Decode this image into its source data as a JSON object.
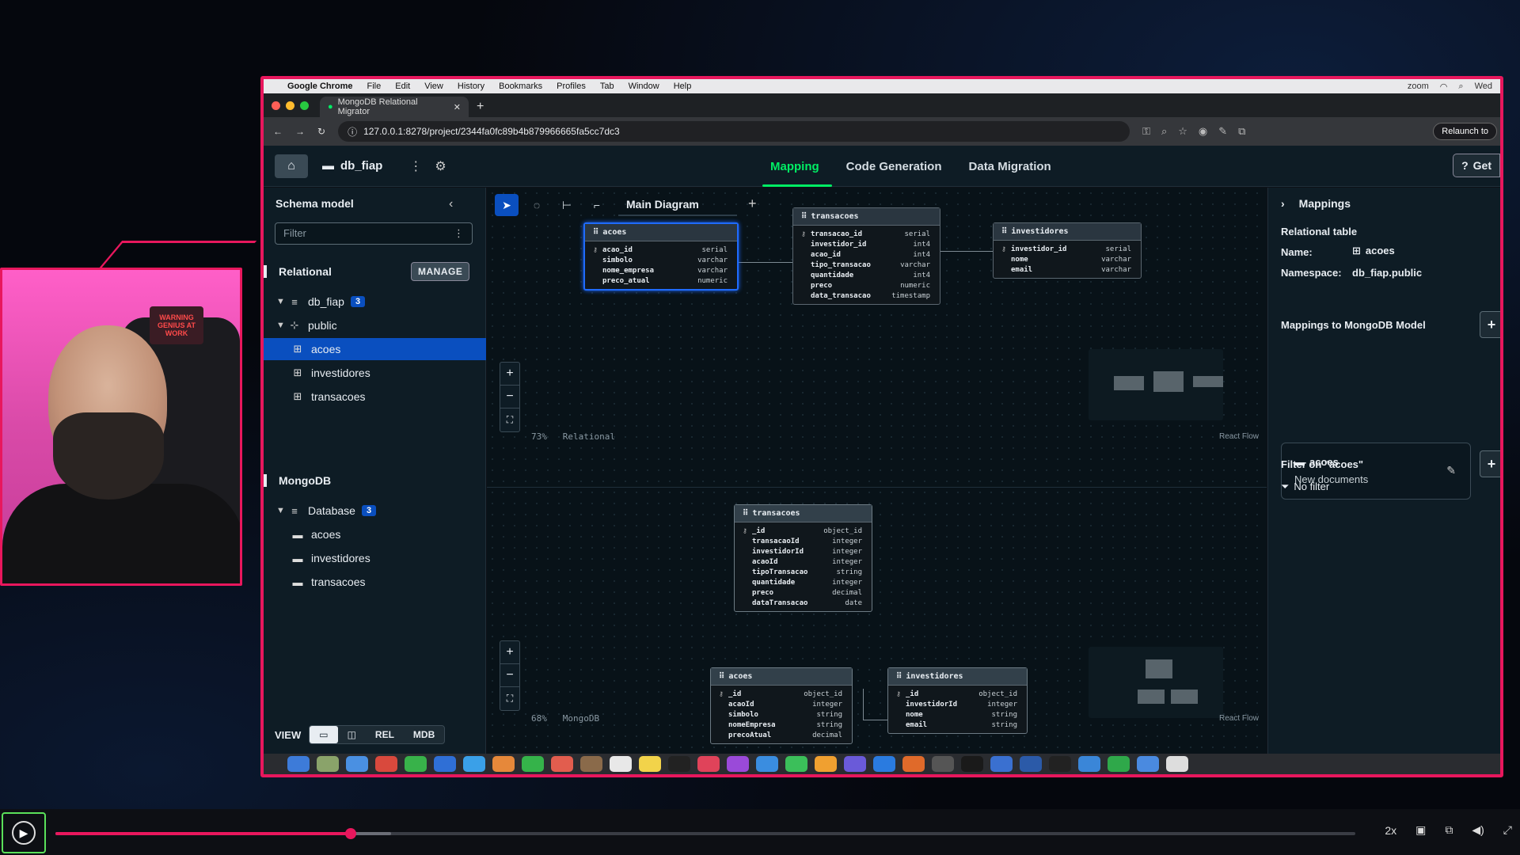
{
  "macos_menu": {
    "app": "Google Chrome",
    "items": [
      "File",
      "Edit",
      "View",
      "History",
      "Bookmarks",
      "Profiles",
      "Tab",
      "Window",
      "Help"
    ],
    "zoom": "zoom",
    "clock": "Wed"
  },
  "browser": {
    "tab_title": "MongoDB Relational Migrator",
    "url": "127.0.0.1:8278/project/2344fa0fc89b4b879966665fa5cc7dc3",
    "relaunch": "Relaunch to"
  },
  "app": {
    "project": "db_fiap",
    "tabs": [
      {
        "label": "Mapping",
        "active": true
      },
      {
        "label": "Code Generation",
        "active": false
      },
      {
        "label": "Data Migration",
        "active": false
      }
    ],
    "get_button": "Get"
  },
  "sidebar": {
    "title": "Schema model",
    "filter_placeholder": "Filter",
    "relational_label": "Relational",
    "manage": "MANAGE",
    "relational_tree": [
      {
        "label": "db_fiap",
        "badge": "3",
        "kind": "db"
      },
      {
        "label": "public",
        "kind": "schema"
      },
      {
        "label": "acoes",
        "kind": "table",
        "selected": true
      },
      {
        "label": "investidores",
        "kind": "table"
      },
      {
        "label": "transacoes",
        "kind": "table"
      }
    ],
    "mongodb_label": "MongoDB",
    "mongo_tree": [
      {
        "label": "Database",
        "badge": "3",
        "kind": "db"
      },
      {
        "label": "acoes",
        "kind": "collection"
      },
      {
        "label": "investidores",
        "kind": "collection"
      },
      {
        "label": "transacoes",
        "kind": "collection"
      }
    ],
    "view_label": "VIEW",
    "view_options": [
      "REL",
      "MDB"
    ]
  },
  "diagram": {
    "tab": "Main Diagram",
    "relational_zoom": "73%",
    "relational_label": "Relational",
    "mongo_zoom": "68%",
    "mongo_label": "MongoDB",
    "react_flow": "React Flow",
    "relational_tables": [
      {
        "name": "acoes",
        "fields": [
          [
            "acao_id",
            "serial"
          ],
          [
            "simbolo",
            "varchar"
          ],
          [
            "nome_empresa",
            "varchar"
          ],
          [
            "preco_atual",
            "numeric"
          ]
        ]
      },
      {
        "name": "transacoes",
        "fields": [
          [
            "transacao_id",
            "serial"
          ],
          [
            "investidor_id",
            "int4"
          ],
          [
            "acao_id",
            "int4"
          ],
          [
            "tipo_transacao",
            "varchar"
          ],
          [
            "quantidade",
            "int4"
          ],
          [
            "preco",
            "numeric"
          ],
          [
            "data_transacao",
            "timestamp"
          ]
        ]
      },
      {
        "name": "investidores",
        "fields": [
          [
            "investidor_id",
            "serial"
          ],
          [
            "nome",
            "varchar"
          ],
          [
            "email",
            "varchar"
          ]
        ]
      }
    ],
    "mongo_collections": [
      {
        "name": "transacoes",
        "fields": [
          [
            "_id",
            "object_id"
          ],
          [
            "transacaoId",
            "integer"
          ],
          [
            "investidorId",
            "integer"
          ],
          [
            "acaoId",
            "integer"
          ],
          [
            "tipoTransacao",
            "string"
          ],
          [
            "quantidade",
            "integer"
          ],
          [
            "preco",
            "decimal"
          ],
          [
            "dataTransacao",
            "date"
          ]
        ]
      },
      {
        "name": "acoes",
        "fields": [
          [
            "_id",
            "object_id"
          ],
          [
            "acaoId",
            "integer"
          ],
          [
            "simbolo",
            "string"
          ],
          [
            "nomeEmpresa",
            "string"
          ],
          [
            "precoAtual",
            "decimal"
          ]
        ]
      },
      {
        "name": "investidores",
        "fields": [
          [
            "_id",
            "object_id"
          ],
          [
            "investidorId",
            "integer"
          ],
          [
            "nome",
            "string"
          ],
          [
            "email",
            "string"
          ]
        ]
      }
    ]
  },
  "right_panel": {
    "title": "Mappings",
    "section": "Relational table",
    "name_label": "Name:",
    "name_value": "acoes",
    "namespace_label": "Namespace:",
    "namespace_value": "db_fiap.public",
    "mappings_title": "Mappings to MongoDB Model",
    "mapping_card": {
      "name": "acoes",
      "sub": "New documents"
    },
    "filter_title": "Filter on \"acoes\"",
    "filter_value": "No filter"
  },
  "webcam": {
    "sign": "WARNING GENIUS AT WORK"
  },
  "player": {
    "progress": 0.227,
    "buffered": 0.258,
    "speed": "2x"
  },
  "colors": {
    "accent_green": "#00ed64",
    "selection_blue": "#0a4fbf",
    "frame_pink": "#e8175d"
  }
}
